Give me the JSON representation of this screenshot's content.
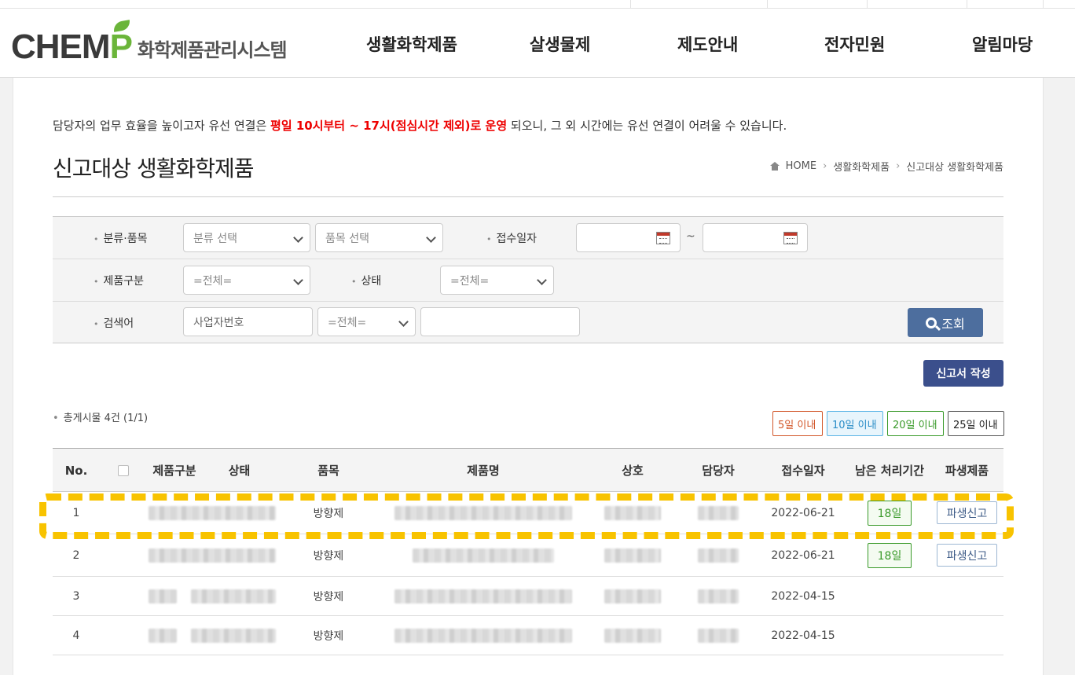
{
  "logo": {
    "brand_main": "CHEM",
    "brand_p": "P",
    "tagline": "화학제품관리시스템"
  },
  "nav": [
    "생활화학제품",
    "살생물제",
    "제도안내",
    "전자민원",
    "알림마당"
  ],
  "notice": {
    "before": "담당자의 업무 효율을 높이고자 유선 연결은 ",
    "highlight": "평일 10시부터 ~ 17시(점심시간 제외)로 운영",
    "after": " 되오니, 그 외 시간에는 유선 연결이 어려울 수 있습니다."
  },
  "page_title": "신고대상 생활화학제품",
  "breadcrumb": {
    "home": "HOME",
    "level1": "생활화학제품",
    "level2": "신고대상 생활화학제품"
  },
  "search": {
    "category_label": "분류·품목",
    "category_select": "분류 선택",
    "item_select": "품목 선택",
    "date_label": "접수일자",
    "date_from": "",
    "date_to": "",
    "tilde": "~",
    "product_type_label": "제품구분",
    "product_type_value": "=전체=",
    "status_label": "상태",
    "status_value": "=전체=",
    "keyword_label": "검색어",
    "keyword_field_placeholder": "사업자번호",
    "keyword_type_value": "=전체=",
    "keyword_value": "",
    "search_button": "조회"
  },
  "report_button": "신고서 작성",
  "total_text": "총게시물 4건 (1/1)",
  "filters": [
    "5일 이내",
    "10일 이내",
    "20일 이내",
    "25일 이내"
  ],
  "table": {
    "headers": [
      "No.",
      "",
      "제품구분",
      "상태",
      "품목",
      "제품명",
      "상호",
      "담당자",
      "접수일자",
      "남은 처리기간",
      "파생제품"
    ],
    "rows": [
      {
        "no": "1",
        "item": "방향제",
        "date": "2022-06-21",
        "remaining": "18일",
        "derived": "파생신고"
      },
      {
        "no": "2",
        "item": "방향제",
        "date": "2022-06-21",
        "remaining": "18일",
        "derived": "파생신고"
      },
      {
        "no": "3",
        "item": "방향제",
        "date": "2022-04-15",
        "remaining": "",
        "derived": ""
      },
      {
        "no": "4",
        "item": "방향제",
        "date": "2022-04-15",
        "remaining": "",
        "derived": ""
      }
    ]
  },
  "colors": {
    "accent_green": "#6bb53a",
    "search_button": "#4d6e9e",
    "report_button": "#3b4f8c",
    "notice_red": "#ee0000",
    "highlight_yellow": "#f8c300"
  }
}
